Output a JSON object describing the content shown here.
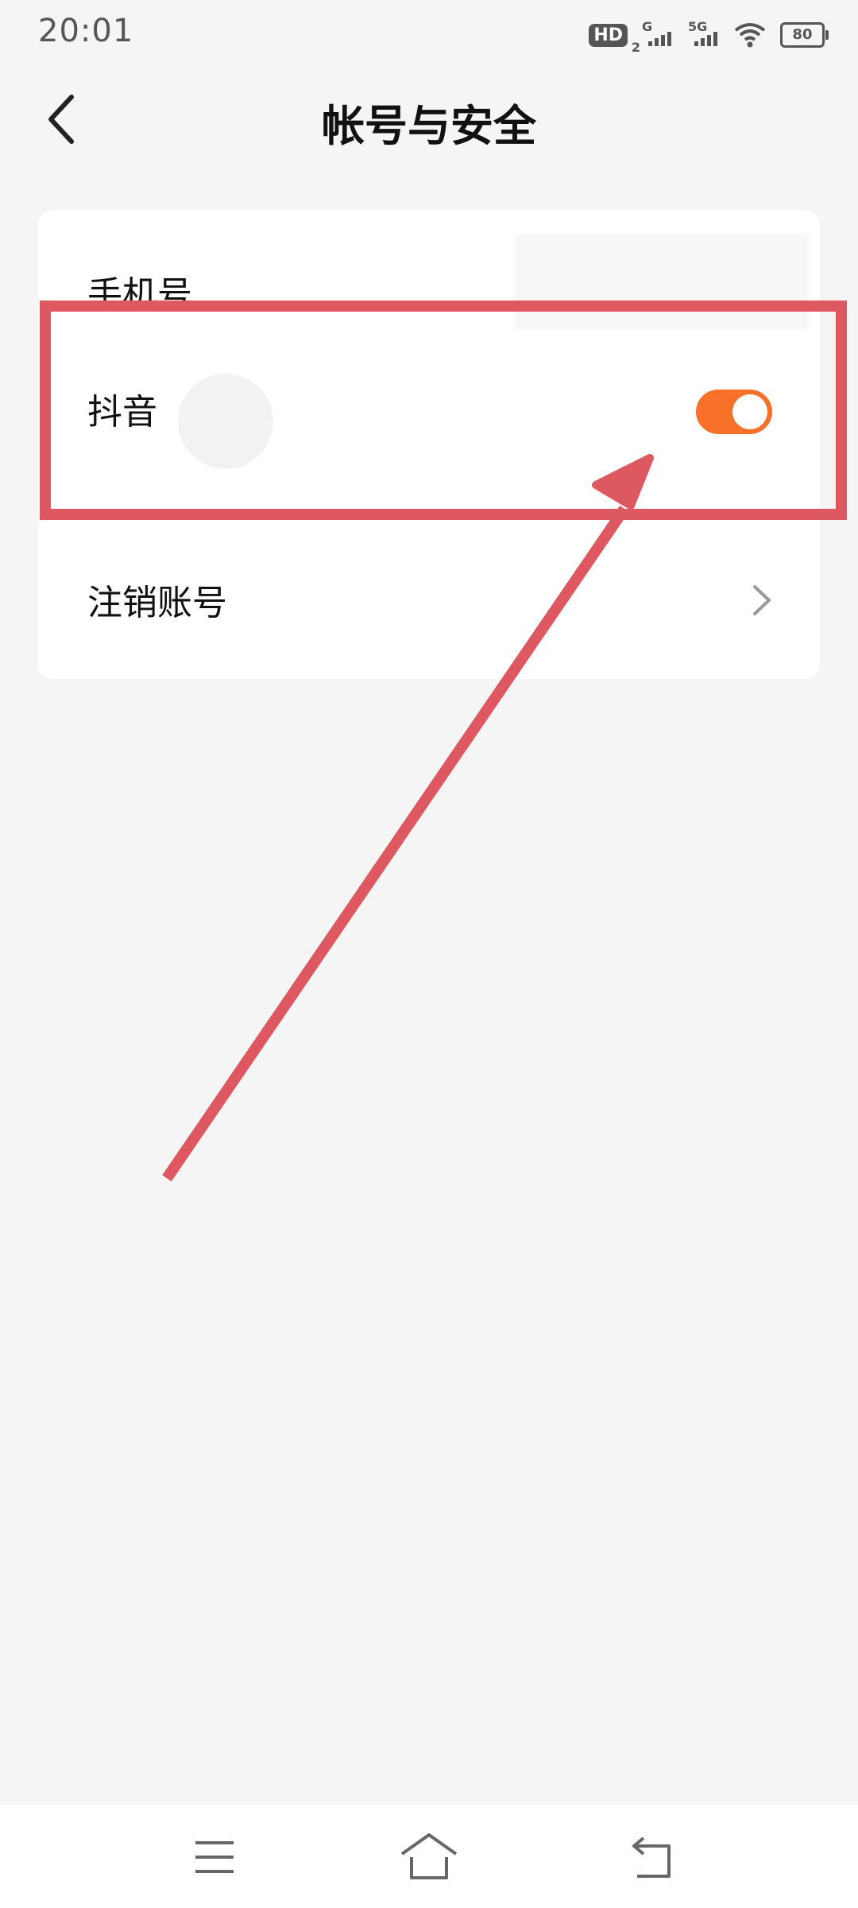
{
  "status_bar": {
    "time": "20:01",
    "hd_label": "HD",
    "hd_sub": "2",
    "net1_label": "G",
    "net2_label": "5G",
    "battery": "80"
  },
  "header": {
    "title": "帐号与安全",
    "back_icon": "chevron-left-icon"
  },
  "settings": {
    "phone_label": "手机号",
    "douyin_label": "抖音",
    "douyin_toggle_on": true,
    "delete_account_label": "注销账号"
  },
  "colors": {
    "accent": "#f7712a",
    "annotation": "#dd5860",
    "background": "#f5f5f5"
  },
  "bottom_nav": {
    "menu_icon": "menu-icon",
    "home_icon": "home-icon",
    "back_icon": "back-icon"
  }
}
